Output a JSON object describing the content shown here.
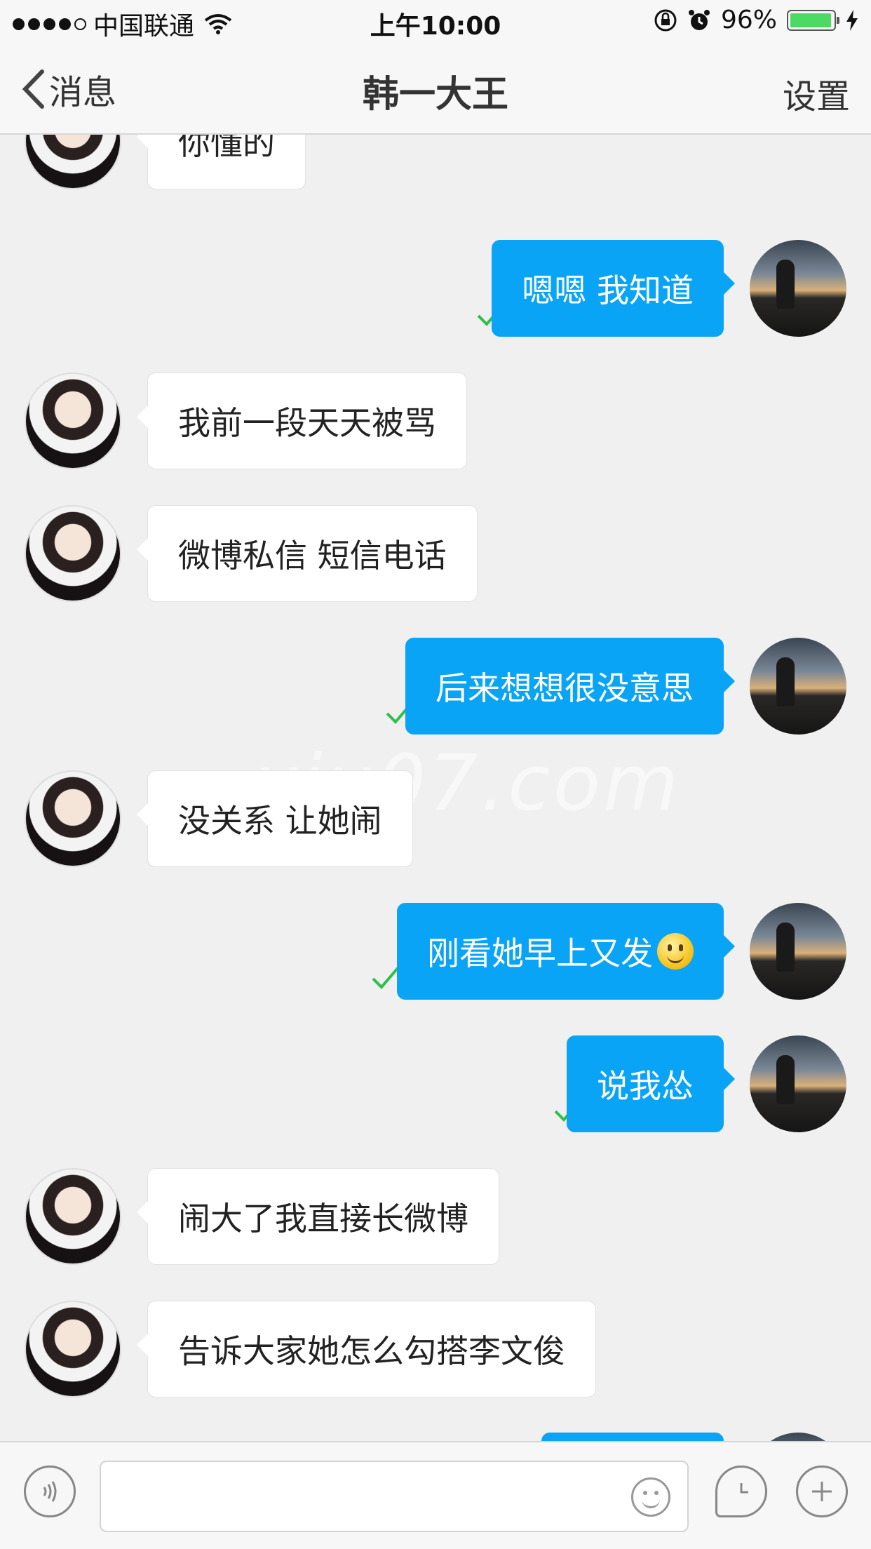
{
  "status_bar": {
    "carrier": "中国联通",
    "time": "上午10:00",
    "battery": "96%",
    "battery_level": 0.96,
    "signal_bars": 4
  },
  "nav": {
    "back_label": "消息",
    "title": "韩一大王",
    "settings_label": "设置"
  },
  "watermark": "xiu07.com",
  "messages": [
    {
      "side": "left",
      "text": "你懂的"
    },
    {
      "side": "right",
      "text": "嗯嗯 我知道",
      "read": true
    },
    {
      "side": "left",
      "text": "我前一段天天被骂"
    },
    {
      "side": "left",
      "text": "微博私信 短信电话"
    },
    {
      "side": "right",
      "text": "后来想想很没意思",
      "read": true
    },
    {
      "side": "left",
      "text": "没关系 让她闹"
    },
    {
      "side": "right",
      "text": "刚看她早上又发",
      "emoji": "smiley",
      "read": true
    },
    {
      "side": "right",
      "text": "说我怂",
      "read": true
    },
    {
      "side": "left",
      "text": "闹大了我直接长微博"
    },
    {
      "side": "left",
      "text": "告诉大家她怎么勾搭李文俊"
    }
  ],
  "colors": {
    "bubble_sent": "#0aa4f6",
    "bubble_received": "#ffffff",
    "read_check": "#2fbf4a",
    "chat_background": "#f0f0f0"
  },
  "input_bar": {
    "icons": [
      "voice-icon",
      "emoji-icon",
      "history-icon",
      "add-icon"
    ]
  }
}
